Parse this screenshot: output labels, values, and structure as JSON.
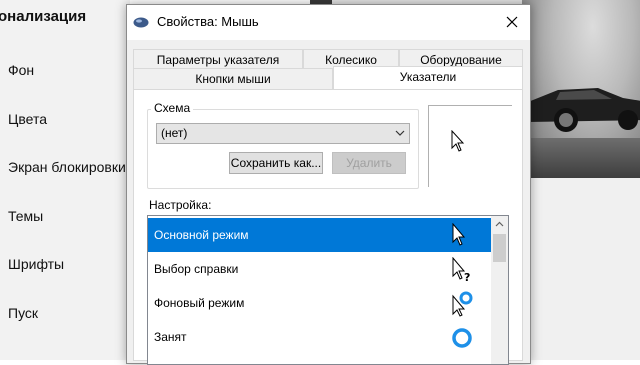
{
  "settings": {
    "title": "онализация",
    "nav": [
      "Фон",
      "Цвета",
      "Экран блокировки",
      "Темы",
      "Шрифты",
      "Пуск"
    ]
  },
  "dialog": {
    "title": "Свойства: Мышь",
    "tabs_back": [
      "Параметры указателя",
      "Колесико",
      "Оборудование"
    ],
    "tabs_front": [
      "Кнопки мыши",
      "Указатели"
    ],
    "selected_tab": "Указатели",
    "scheme_label": "Схема",
    "scheme_value": "(нет)",
    "save_as_label": "Сохранить как...",
    "delete_label": "Удалить",
    "customize_label": "Настройка:",
    "list_items": [
      {
        "label": "Основной режим",
        "icon": "arrow-cursor-icon",
        "selected": true
      },
      {
        "label": "Выбор справки",
        "icon": "help-cursor-icon",
        "selected": false
      },
      {
        "label": "Фоновый режим",
        "icon": "working-in-background-cursor-icon",
        "selected": false
      },
      {
        "label": "Занят",
        "icon": "busy-cursor-icon",
        "selected": false
      }
    ]
  },
  "colors": {
    "accent": "#0078d7",
    "dialog_bg": "#f0f0f0",
    "busy_ring": "#1e90e8"
  }
}
